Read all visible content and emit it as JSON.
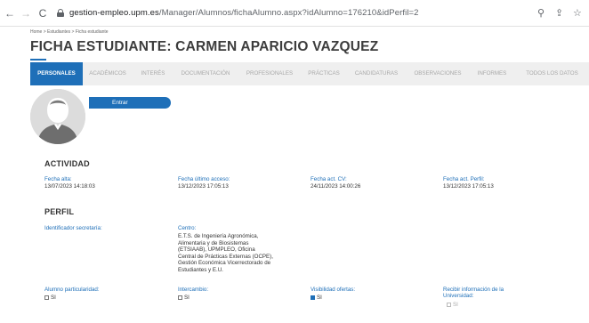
{
  "browser": {
    "url_host": "gestion-empleo.upm.es",
    "url_path": "/Manager/Alumnos/fichaAlumno.aspx?idAlumno=176210&idPerfil=2",
    "back_icon": "←",
    "forward_icon": "→",
    "reload_icon": "C",
    "zoom_icon": "⚲",
    "share_icon": "⇪",
    "star_icon": "☆"
  },
  "breadcrumb": "Home > Estudiantes > Ficha estudiante",
  "page_title": "FICHA ESTUDIANTE: CARMEN APARICIO VAZQUEZ",
  "accent_color": "#1e6fb8",
  "tabs": [
    {
      "label": "PERSONALES",
      "active": true
    },
    {
      "label": "ACADÉMICOS",
      "active": false
    },
    {
      "label": "INTERÉS",
      "active": false
    },
    {
      "label": "DOCUMENTACIÓN",
      "active": false
    },
    {
      "label": "PROFESIONALES",
      "active": false
    },
    {
      "label": "PRÁCTICAS",
      "active": false
    },
    {
      "label": "CANDIDATURAS",
      "active": false
    },
    {
      "label": "OBSERVACIONES",
      "active": false
    },
    {
      "label": "INFORMES",
      "active": false
    },
    {
      "label": "TODOS LOS DATOS",
      "active": false
    }
  ],
  "enter_button": "Entrar",
  "actividad": {
    "title": "ACTIVIDAD",
    "fields": [
      {
        "label": "Fecha alta:",
        "value": "13/07/2023 14:18:03"
      },
      {
        "label": "Fecha último acceso:",
        "value": "13/12/2023 17:05:13"
      },
      {
        "label": "Fecha act. CV:",
        "value": "24/11/2023 14:00:26"
      },
      {
        "label": "Fecha act. Perfil:",
        "value": "13/12/2023 17:05:13"
      }
    ]
  },
  "perfil": {
    "title": "PERFIL",
    "identificador_label": "Identificador secretaría:",
    "identificador_value": "",
    "centro_label": "Centro:",
    "centro_value": "E.T.S. de Ingeniería Agronómica, Alimentaria y de Biosistemas (ETSIAAB), UPMPLEO, Oficina Central de Prácticas Externas (OCPE), Gestión Económica Vicerrectorado de Estudiantes y E.U.",
    "checkboxes": [
      {
        "label": "Alumno particularidad:",
        "option": "SI",
        "checked": false,
        "disabled": false
      },
      {
        "label": "Intercambio:",
        "option": "SI",
        "checked": false,
        "disabled": false
      },
      {
        "label": "Visibilidad ofertas:",
        "option": "SI",
        "checked": true,
        "disabled": false
      },
      {
        "label": "Recibir información de la Universidad:",
        "option": "SI",
        "checked": false,
        "disabled": true
      }
    ]
  }
}
